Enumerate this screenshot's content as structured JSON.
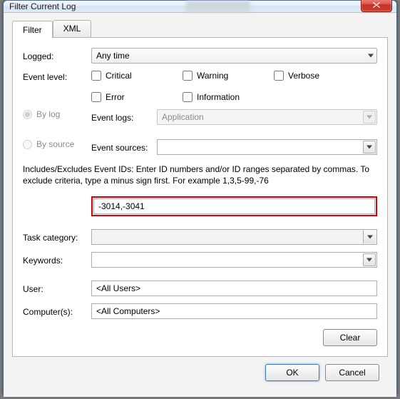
{
  "window": {
    "title": "Filter Current Log"
  },
  "tabs": {
    "filter": "Filter",
    "xml": "XML"
  },
  "labels": {
    "logged": "Logged:",
    "event_level": "Event level:",
    "by_log": "By log",
    "by_source": "By source",
    "event_logs": "Event logs:",
    "event_sources": "Event sources:",
    "task_category": "Task category:",
    "keywords": "Keywords:",
    "user": "User:",
    "computers": "Computer(s):"
  },
  "logged_value": "Any time",
  "levels": {
    "critical": "Critical",
    "warning": "Warning",
    "verbose": "Verbose",
    "error": "Error",
    "information": "Information"
  },
  "event_logs_value": "Application",
  "event_sources_value": "",
  "instructions": "Includes/Excludes Event IDs: Enter ID numbers and/or ID ranges separated by commas. To exclude criteria, type a minus sign first. For example 1,3,5-99,-76",
  "event_ids_value": "-3014,-3041",
  "task_category_value": "",
  "keywords_value": "",
  "user_value": "<All Users>",
  "computers_value": "<All Computers>",
  "buttons": {
    "clear": "Clear",
    "ok": "OK",
    "cancel": "Cancel"
  }
}
